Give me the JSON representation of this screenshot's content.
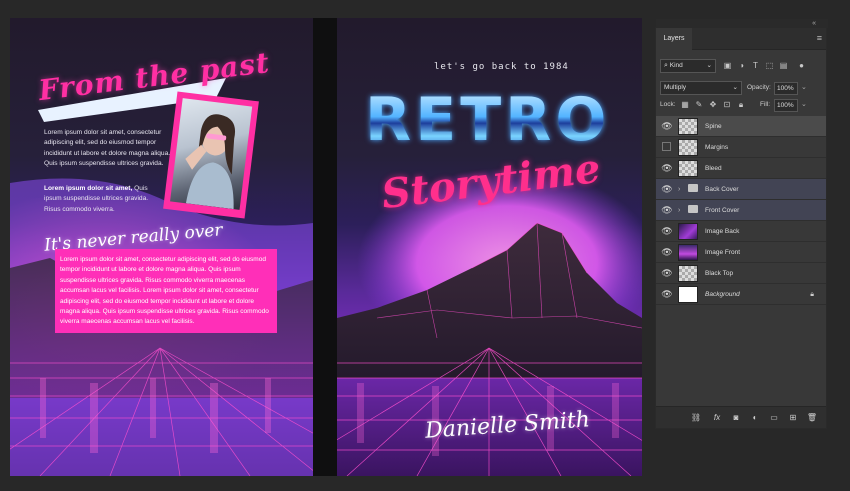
{
  "canvas": {
    "back_cover": {
      "title": "From the past",
      "paragraph1": "Lorem ipsum dolor sit amet, consectetur adipiscing elit, sed do eiusmod tempor incididunt ut labore et dolore magna aliqua. Quis ipsum suspendisse ultrices gravida.",
      "paragraph2_bold": "Lorem ipsum dolor sit amet,",
      "paragraph2_rest": "Quis ipsum suspendisse ultrices gravida. Risus commodo viverra.",
      "subtitle": "It's never really over",
      "pink_box_text": "Lorem ipsum dolor sit amet, consectetur adipiscing elit, sed do eiusmod tempor incididunt ut labore et dolore magna aliqua. Quis ipsum suspendisse ultrices gravida. Risus commodo viverra maecenas accumsan lacus vel facilisis. Lorem ipsum dolor sit amet, consectetur adipiscing elit, sed do eiusmod tempor incididunt ut labore et dolore magna aliqua. Quis ipsum suspendisse ultrices gravida. Risus commodo viverra maecenas accumsan lacus vel facilisis."
    },
    "front_cover": {
      "tagline": "let's go back to 1984",
      "title_main": "RETRO",
      "title_script": "Storytime",
      "author": "Danielle Smith"
    }
  },
  "layers_panel": {
    "tab": "Layers",
    "filter_kind": "Kind",
    "blend_mode": "Multiply",
    "opacity_label": "Opacity:",
    "opacity_value": "100%",
    "lock_label": "Lock:",
    "fill_label": "Fill:",
    "fill_value": "100%",
    "layers": [
      {
        "name": "Spine",
        "visible": true,
        "selected": true
      },
      {
        "name": "Margins",
        "visible": false
      },
      {
        "name": "Bleed",
        "visible": true
      },
      {
        "name": "Back Cover",
        "visible": true,
        "group": true
      },
      {
        "name": "Front Cover",
        "visible": true,
        "group": true
      },
      {
        "name": "Image Back",
        "visible": true
      },
      {
        "name": "Image Front",
        "visible": true
      },
      {
        "name": "Black Top",
        "visible": true
      },
      {
        "name": "Background",
        "visible": true,
        "locked": true
      }
    ]
  }
}
